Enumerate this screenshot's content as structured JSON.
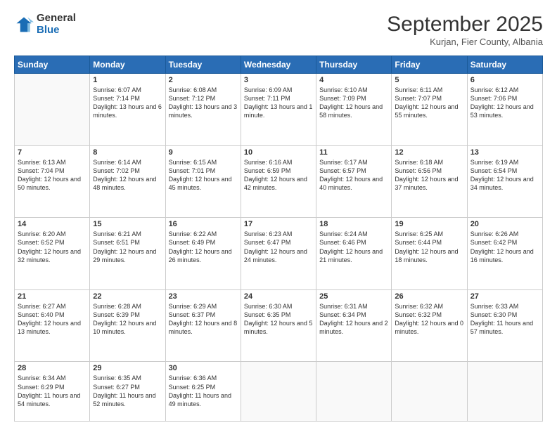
{
  "logo": {
    "general": "General",
    "blue": "Blue"
  },
  "header": {
    "month": "September 2025",
    "location": "Kurjan, Fier County, Albania"
  },
  "weekdays": [
    "Sunday",
    "Monday",
    "Tuesday",
    "Wednesday",
    "Thursday",
    "Friday",
    "Saturday"
  ],
  "weeks": [
    [
      {
        "day": "",
        "info": ""
      },
      {
        "day": "1",
        "info": "Sunrise: 6:07 AM\nSunset: 7:14 PM\nDaylight: 13 hours\nand 6 minutes."
      },
      {
        "day": "2",
        "info": "Sunrise: 6:08 AM\nSunset: 7:12 PM\nDaylight: 13 hours\nand 3 minutes."
      },
      {
        "day": "3",
        "info": "Sunrise: 6:09 AM\nSunset: 7:11 PM\nDaylight: 13 hours\nand 1 minute."
      },
      {
        "day": "4",
        "info": "Sunrise: 6:10 AM\nSunset: 7:09 PM\nDaylight: 12 hours\nand 58 minutes."
      },
      {
        "day": "5",
        "info": "Sunrise: 6:11 AM\nSunset: 7:07 PM\nDaylight: 12 hours\nand 55 minutes."
      },
      {
        "day": "6",
        "info": "Sunrise: 6:12 AM\nSunset: 7:06 PM\nDaylight: 12 hours\nand 53 minutes."
      }
    ],
    [
      {
        "day": "7",
        "info": "Sunrise: 6:13 AM\nSunset: 7:04 PM\nDaylight: 12 hours\nand 50 minutes."
      },
      {
        "day": "8",
        "info": "Sunrise: 6:14 AM\nSunset: 7:02 PM\nDaylight: 12 hours\nand 48 minutes."
      },
      {
        "day": "9",
        "info": "Sunrise: 6:15 AM\nSunset: 7:01 PM\nDaylight: 12 hours\nand 45 minutes."
      },
      {
        "day": "10",
        "info": "Sunrise: 6:16 AM\nSunset: 6:59 PM\nDaylight: 12 hours\nand 42 minutes."
      },
      {
        "day": "11",
        "info": "Sunrise: 6:17 AM\nSunset: 6:57 PM\nDaylight: 12 hours\nand 40 minutes."
      },
      {
        "day": "12",
        "info": "Sunrise: 6:18 AM\nSunset: 6:56 PM\nDaylight: 12 hours\nand 37 minutes."
      },
      {
        "day": "13",
        "info": "Sunrise: 6:19 AM\nSunset: 6:54 PM\nDaylight: 12 hours\nand 34 minutes."
      }
    ],
    [
      {
        "day": "14",
        "info": "Sunrise: 6:20 AM\nSunset: 6:52 PM\nDaylight: 12 hours\nand 32 minutes."
      },
      {
        "day": "15",
        "info": "Sunrise: 6:21 AM\nSunset: 6:51 PM\nDaylight: 12 hours\nand 29 minutes."
      },
      {
        "day": "16",
        "info": "Sunrise: 6:22 AM\nSunset: 6:49 PM\nDaylight: 12 hours\nand 26 minutes."
      },
      {
        "day": "17",
        "info": "Sunrise: 6:23 AM\nSunset: 6:47 PM\nDaylight: 12 hours\nand 24 minutes."
      },
      {
        "day": "18",
        "info": "Sunrise: 6:24 AM\nSunset: 6:46 PM\nDaylight: 12 hours\nand 21 minutes."
      },
      {
        "day": "19",
        "info": "Sunrise: 6:25 AM\nSunset: 6:44 PM\nDaylight: 12 hours\nand 18 minutes."
      },
      {
        "day": "20",
        "info": "Sunrise: 6:26 AM\nSunset: 6:42 PM\nDaylight: 12 hours\nand 16 minutes."
      }
    ],
    [
      {
        "day": "21",
        "info": "Sunrise: 6:27 AM\nSunset: 6:40 PM\nDaylight: 12 hours\nand 13 minutes."
      },
      {
        "day": "22",
        "info": "Sunrise: 6:28 AM\nSunset: 6:39 PM\nDaylight: 12 hours\nand 10 minutes."
      },
      {
        "day": "23",
        "info": "Sunrise: 6:29 AM\nSunset: 6:37 PM\nDaylight: 12 hours\nand 8 minutes."
      },
      {
        "day": "24",
        "info": "Sunrise: 6:30 AM\nSunset: 6:35 PM\nDaylight: 12 hours\nand 5 minutes."
      },
      {
        "day": "25",
        "info": "Sunrise: 6:31 AM\nSunset: 6:34 PM\nDaylight: 12 hours\nand 2 minutes."
      },
      {
        "day": "26",
        "info": "Sunrise: 6:32 AM\nSunset: 6:32 PM\nDaylight: 12 hours\nand 0 minutes."
      },
      {
        "day": "27",
        "info": "Sunrise: 6:33 AM\nSunset: 6:30 PM\nDaylight: 11 hours\nand 57 minutes."
      }
    ],
    [
      {
        "day": "28",
        "info": "Sunrise: 6:34 AM\nSunset: 6:29 PM\nDaylight: 11 hours\nand 54 minutes."
      },
      {
        "day": "29",
        "info": "Sunrise: 6:35 AM\nSunset: 6:27 PM\nDaylight: 11 hours\nand 52 minutes."
      },
      {
        "day": "30",
        "info": "Sunrise: 6:36 AM\nSunset: 6:25 PM\nDaylight: 11 hours\nand 49 minutes."
      },
      {
        "day": "",
        "info": ""
      },
      {
        "day": "",
        "info": ""
      },
      {
        "day": "",
        "info": ""
      },
      {
        "day": "",
        "info": ""
      }
    ]
  ]
}
